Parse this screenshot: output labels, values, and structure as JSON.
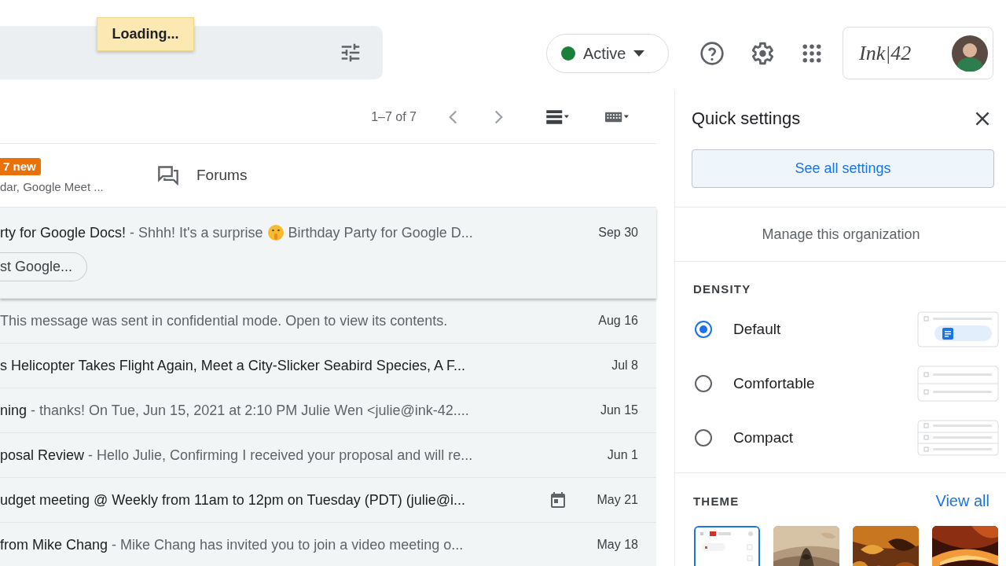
{
  "search": {
    "tooltip": "Loading..."
  },
  "status": {
    "label": "Active",
    "color": "#188038"
  },
  "account": {
    "logo": "Ink|42"
  },
  "toolbar": {
    "range": "1–7 of 7"
  },
  "categories": [
    {
      "badge": "7 new",
      "subtitle": "dar, Google Meet ..."
    },
    {
      "label": "Forums"
    }
  ],
  "emails": [
    {
      "kind": "mail",
      "expanded": true,
      "subject": "rty for Google Docs!",
      "snippet_parts": [
        "- Shhh! It's a surprise",
        "Birthday Party for Google D..."
      ],
      "chip": "st Google...",
      "date": "Sep 30"
    },
    {
      "kind": "mail",
      "expanded": false,
      "snippet_parts": [
        "This message was sent in confidential mode. Open to view its contents."
      ],
      "date": "Aug 16"
    },
    {
      "kind": "mail",
      "expanded": false,
      "subject": "s Helicopter Takes Flight Again, Meet a City-Slicker Seabird Species, A F...",
      "date": "Jul 8"
    },
    {
      "kind": "mail",
      "expanded": false,
      "subject": "ning",
      "snippet_parts": [
        "- thanks! On Tue, Jun 15, 2021 at 2:10 PM Julie Wen <julie@ink-42...."
      ],
      "date": "Jun 15"
    },
    {
      "kind": "mail",
      "expanded": false,
      "subject": "posal Review",
      "snippet_parts": [
        "- Hello Julie, Confirming I received your proposal and will re..."
      ],
      "date": "Jun 1"
    },
    {
      "kind": "event",
      "expanded": false,
      "subject": "udget meeting @ Weekly from 11am to 12pm on Tuesday (PDT) (julie@i...",
      "date": "May 21"
    },
    {
      "kind": "mail",
      "expanded": false,
      "subject": "from Mike Chang",
      "snippet_parts": [
        "- Mike Chang has invited you to join a video meeting o..."
      ],
      "date": "May 18"
    }
  ],
  "quick_settings": {
    "title": "Quick settings",
    "see_all": "See all settings",
    "manage": "Manage this organization",
    "density_heading": "DENSITY",
    "density": [
      {
        "label": "Default",
        "kind": "default",
        "selected": true
      },
      {
        "label": "Comfortable",
        "kind": "comfortable",
        "selected": false
      },
      {
        "label": "Compact",
        "kind": "compact",
        "selected": false
      }
    ],
    "theme_heading": "THEME",
    "view_all": "View all",
    "themes": [
      {
        "kind": "default",
        "selected": true
      },
      {
        "kind": "picture",
        "selected": false
      },
      {
        "kind": "picture",
        "selected": false
      },
      {
        "kind": "picture",
        "selected": false
      }
    ]
  }
}
